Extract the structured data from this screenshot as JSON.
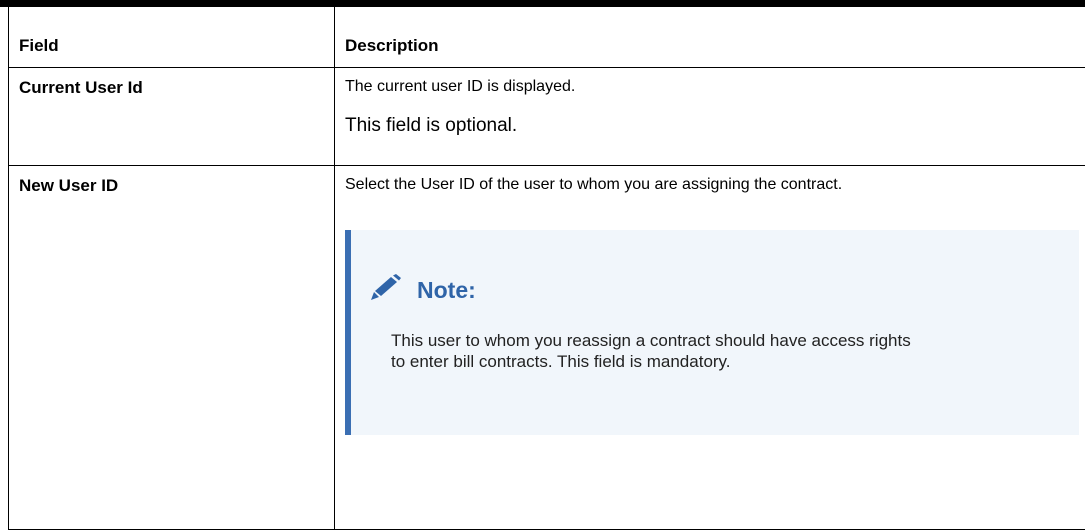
{
  "table": {
    "headers": {
      "field": "Field",
      "description": "Description"
    },
    "rows": [
      {
        "field": "Current User Id",
        "description": [
          "The current user ID is displayed.",
          "This field is optional."
        ]
      },
      {
        "field": "New User ID",
        "description": [
          "Select the User ID of the user to whom you are assigning the contract."
        ],
        "note": {
          "title": "Note:",
          "text": "This user to whom you reassign a contract should have access rights to enter bill contracts. This field is mandatory.",
          "icon": "pencil-icon"
        }
      }
    ]
  },
  "colors": {
    "note_accent": "#3b6fb3",
    "note_background": "#f1f6fb",
    "note_title": "#2f64a8"
  }
}
